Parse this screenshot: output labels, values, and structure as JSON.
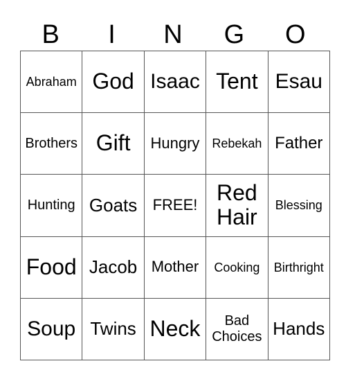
{
  "header": [
    "B",
    "I",
    "N",
    "G",
    "O"
  ],
  "rows": [
    [
      "Abraham",
      "God",
      "Isaac",
      "Tent",
      "Esau"
    ],
    [
      "Brothers",
      "Gift",
      "Hungry",
      "Rebekah",
      "Father"
    ],
    [
      "Hunting",
      "Goats",
      "FREE!",
      "Red Hair",
      "Blessing"
    ],
    [
      "Food",
      "Jacob",
      "Mother",
      "Cooking",
      "Birthright"
    ],
    [
      "Soup",
      "Twins",
      "Neck",
      "Bad Choices",
      "Hands"
    ]
  ],
  "multiline": {
    "red": "Red",
    "hair": "Hair",
    "bad": "Bad",
    "choices": "Choices"
  }
}
